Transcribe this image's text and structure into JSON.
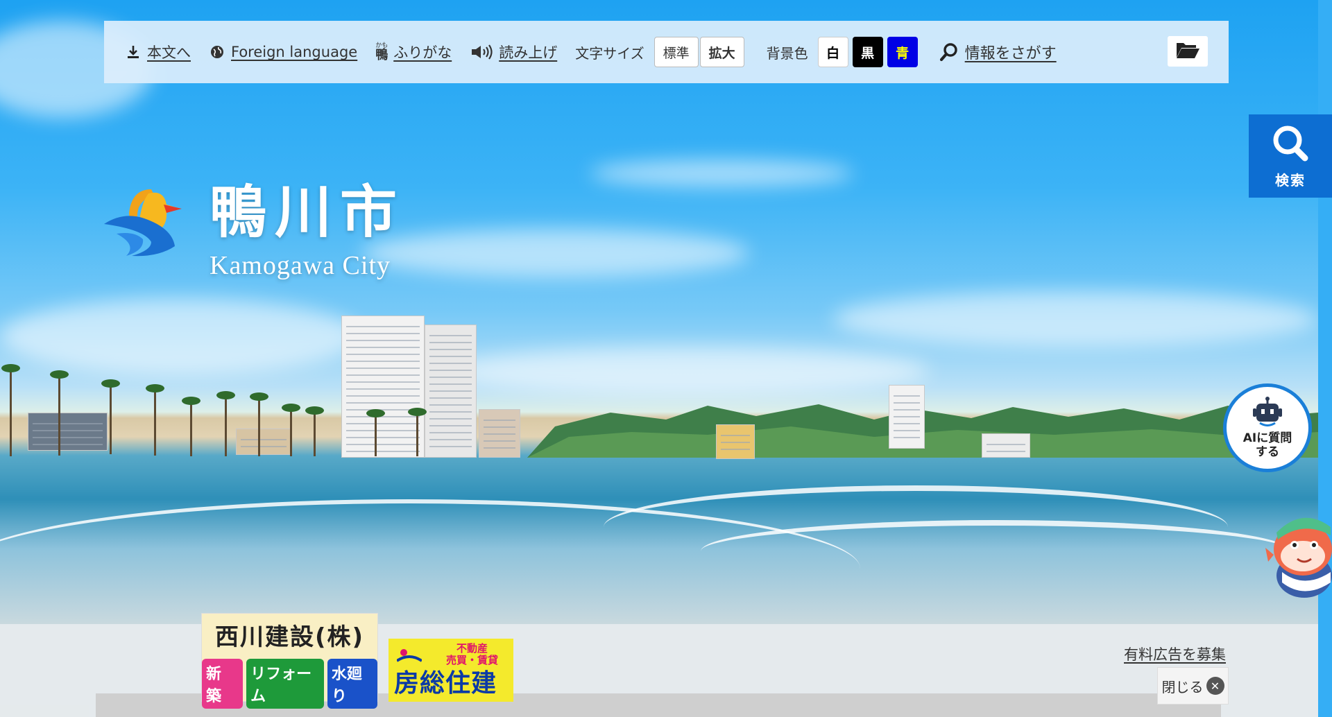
{
  "topbar": {
    "skip_label": "本文へ",
    "foreign_label": "Foreign language",
    "furigana_icon_top": "かも",
    "furigana_icon_main": "鴨",
    "furigana_label": "ふりがな",
    "readaloud_label": "読み上げ",
    "textsize_label": "文字サイズ",
    "textsize_standard": "標準",
    "textsize_large": "拡大",
    "bgcolor_label": "背景色",
    "bg_white": "白",
    "bg_black": "黒",
    "bg_blue": "青",
    "search_label": "情報をさがす"
  },
  "side_search": {
    "label": "検索"
  },
  "logo": {
    "name_ja": "鴨川市",
    "name_en": "Kamogawa City"
  },
  "ai_button": {
    "line1": "AIに質問",
    "line2": "する"
  },
  "ads": {
    "ad1_name": "西川建設(株)",
    "ad1_tags": [
      "新 築",
      "リフォーム",
      "水廻り"
    ],
    "ad2_sub_line1": "不動産",
    "ad2_sub_line2": "売買・賃貸",
    "ad2_main": "房総住建",
    "recruit_label": "有料広告を募集",
    "close_label": "閉じる"
  },
  "colors": {
    "topbar_bg": "#dceefc",
    "side_search_bg": "#0d6ed2",
    "bg_blue_button": "#0000e6",
    "ad1_tag_colors": [
      "#e8388a",
      "#1e9a3a",
      "#1a52c9"
    ]
  },
  "icons": [
    "download-icon",
    "globe-icon",
    "speaker-icon",
    "search-icon",
    "folder-icon",
    "close-icon",
    "robot-icon"
  ]
}
